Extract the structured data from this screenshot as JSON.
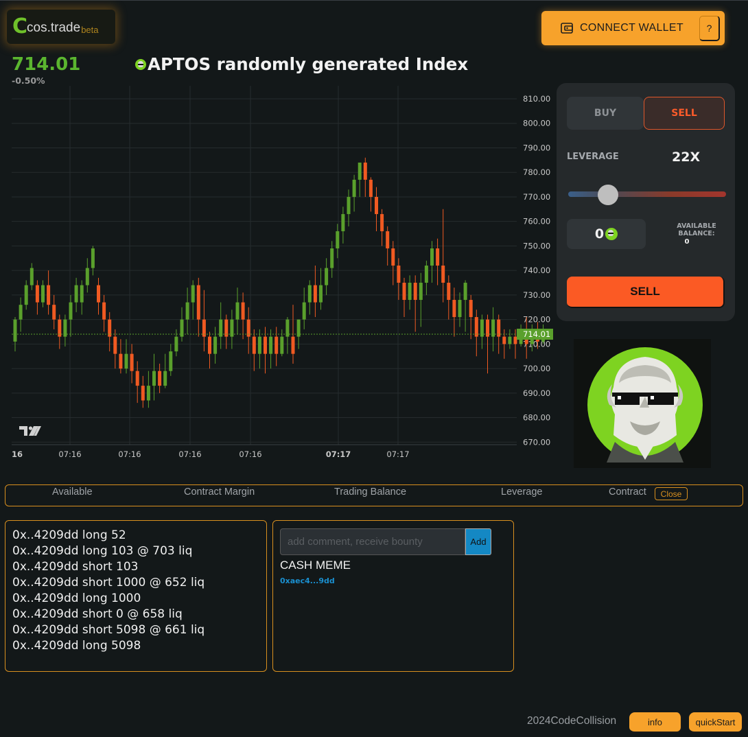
{
  "header": {
    "logo_letter": "C",
    "logo_name": "cos.trade",
    "logo_tag": "beta",
    "connect_wallet_label": "CONNECT WALLET",
    "wallet_icon": "wallet-icon",
    "help_label": "?"
  },
  "market": {
    "price": "714.01",
    "change": "-0.50%",
    "title": "APTOS randomly generated Index",
    "token_icon": "meme-coin-icon"
  },
  "chart_data": {
    "type": "candlestick",
    "y_ticks": [
      "810.00",
      "800.00",
      "790.00",
      "780.00",
      "770.00",
      "760.00",
      "750.00",
      "740.00",
      "730.00",
      "720.00",
      "710.00",
      "700.00",
      "690.00",
      "680.00",
      "670.00"
    ],
    "ylim": [
      670,
      810
    ],
    "x_tick_labels": [
      "16",
      "07:16",
      "07:16",
      "07:16",
      "07:16",
      "07:17",
      "07:17"
    ],
    "x_tick_bold": [
      true,
      false,
      false,
      false,
      false,
      true,
      false
    ],
    "last_price_label": "714.01",
    "last_price": 714.01,
    "grid": true,
    "colors": {
      "up": "#5aa02c",
      "down": "#f05a22",
      "grid": "#262c2e",
      "axis_text": "#c8c8c8",
      "price_line": "#5aa02c"
    },
    "candles": [
      [
        711,
        720,
        707,
        721
      ],
      [
        720,
        726,
        715,
        729
      ],
      [
        726,
        734,
        724,
        736
      ],
      [
        734,
        741,
        732,
        743
      ],
      [
        734,
        727,
        722,
        736
      ],
      [
        727,
        734,
        725,
        736
      ],
      [
        734,
        726,
        722,
        740
      ],
      [
        726,
        720,
        716,
        730
      ],
      [
        720,
        713,
        708,
        722
      ],
      [
        713,
        720,
        709,
        722
      ],
      [
        720,
        727,
        713,
        730
      ],
      [
        727,
        734,
        723,
        737
      ],
      [
        727,
        734,
        722,
        736
      ],
      [
        734,
        741,
        731,
        745
      ],
      [
        741,
        749,
        738,
        750
      ],
      [
        734,
        727,
        722,
        737
      ],
      [
        727,
        720,
        715,
        730
      ],
      [
        720,
        713,
        707,
        723
      ],
      [
        713,
        706,
        700,
        716
      ],
      [
        706,
        700,
        698,
        712
      ],
      [
        700,
        706,
        698,
        712
      ],
      [
        706,
        699,
        694,
        710
      ],
      [
        699,
        693,
        686,
        703
      ],
      [
        693,
        687,
        684,
        697
      ],
      [
        687,
        693,
        684,
        699
      ],
      [
        693,
        699,
        687,
        706
      ],
      [
        699,
        693,
        690,
        702
      ],
      [
        693,
        699,
        692,
        706
      ],
      [
        699,
        707,
        697,
        710
      ],
      [
        707,
        713,
        705,
        716
      ],
      [
        713,
        720,
        711,
        725
      ],
      [
        720,
        727,
        714,
        733
      ],
      [
        727,
        734,
        720,
        736
      ],
      [
        734,
        720,
        713,
        737
      ],
      [
        720,
        713,
        707,
        732
      ],
      [
        713,
        706,
        700,
        715
      ],
      [
        706,
        713,
        702,
        717
      ],
      [
        713,
        720,
        708,
        727
      ],
      [
        720,
        713,
        708,
        722
      ],
      [
        713,
        720,
        708,
        724
      ],
      [
        720,
        727,
        714,
        733
      ],
      [
        727,
        720,
        712,
        731
      ],
      [
        720,
        713,
        706,
        725
      ],
      [
        713,
        706,
        699,
        716
      ],
      [
        706,
        713,
        700,
        716
      ],
      [
        713,
        706,
        698,
        717
      ],
      [
        706,
        713,
        700,
        716
      ],
      [
        713,
        706,
        701,
        717
      ],
      [
        706,
        713,
        705,
        716
      ],
      [
        713,
        720,
        706,
        721
      ],
      [
        713,
        706,
        702,
        726
      ],
      [
        713,
        720,
        708,
        720
      ],
      [
        720,
        727,
        716,
        733
      ],
      [
        727,
        734,
        722,
        736
      ],
      [
        734,
        727,
        721,
        742
      ],
      [
        727,
        734,
        724,
        741
      ],
      [
        734,
        741,
        730,
        745
      ],
      [
        741,
        749,
        737,
        752
      ],
      [
        749,
        756,
        745,
        759
      ],
      [
        756,
        763,
        751,
        766
      ],
      [
        763,
        770,
        758,
        773
      ],
      [
        770,
        777,
        764,
        779
      ],
      [
        777,
        784,
        770,
        783
      ],
      [
        784,
        777,
        770,
        786
      ],
      [
        777,
        770,
        764,
        778
      ],
      [
        770,
        763,
        756,
        774
      ],
      [
        763,
        756,
        750,
        765
      ],
      [
        756,
        749,
        742,
        758
      ],
      [
        749,
        742,
        734,
        752
      ],
      [
        742,
        735,
        728,
        745
      ],
      [
        735,
        728,
        721,
        737
      ],
      [
        728,
        735,
        724,
        738
      ],
      [
        735,
        728,
        715,
        738
      ],
      [
        728,
        735,
        717,
        739
      ],
      [
        735,
        742,
        730,
        744
      ],
      [
        742,
        749,
        735,
        752
      ],
      [
        749,
        742,
        734,
        753
      ],
      [
        742,
        735,
        727,
        765
      ],
      [
        735,
        728,
        720,
        738
      ],
      [
        728,
        721,
        713,
        733
      ],
      [
        721,
        728,
        717,
        731
      ],
      [
        728,
        735,
        715,
        736
      ],
      [
        728,
        721,
        712,
        730
      ],
      [
        721,
        713,
        705,
        724
      ],
      [
        713,
        720,
        708,
        722
      ],
      [
        720,
        713,
        698,
        722
      ],
      [
        713,
        720,
        707,
        725
      ],
      [
        720,
        713,
        706,
        722
      ],
      [
        713,
        710,
        704,
        716
      ],
      [
        710,
        713,
        708,
        716
      ],
      [
        713,
        710,
        704,
        716
      ],
      [
        710,
        714,
        709,
        718
      ],
      [
        714,
        710,
        704,
        721
      ],
      [
        710,
        714,
        707,
        718
      ],
      [
        714,
        711,
        708,
        719
      ],
      [
        711,
        714,
        710,
        718
      ]
    ]
  },
  "trade_panel": {
    "buy_label": "BUY",
    "sell_tab_label": "SELL",
    "leverage_label": "LEVERAGE",
    "leverage_value": "22X",
    "leverage_fraction": 0.22,
    "amount_value": "0",
    "available_label_line1": "AVAILABLE",
    "available_label_line2": "BALANCE:",
    "available_value": "0",
    "sell_button_label": "SELL"
  },
  "stats_bar": {
    "available": "Available",
    "contract_margin": "Contract Margin",
    "trading_balance": "Trading Balance",
    "leverage": "Leverage",
    "contract": "Contract",
    "close_label": "Close"
  },
  "trades": [
    "0x..4209dd long 52",
    "0x..4209dd long 103 @ 703 liq",
    "0x..4209dd short 103",
    "0x..4209dd short 1000 @ 652 liq",
    "0x..4209dd long 1000",
    "0x..4209dd short 0 @ 658 liq",
    "0x..4209dd short 5098 @ 661 liq",
    "0x..4209dd long 5098"
  ],
  "comments": {
    "placeholder": "add comment, receive bounty",
    "add_label": "Add",
    "items": [
      {
        "text": "CASH MEME",
        "author": "0xaec4...9dd"
      }
    ]
  },
  "footer": {
    "credit": "2024CodeCollision",
    "info_label": "info",
    "quickstart_label": "quickStart"
  }
}
